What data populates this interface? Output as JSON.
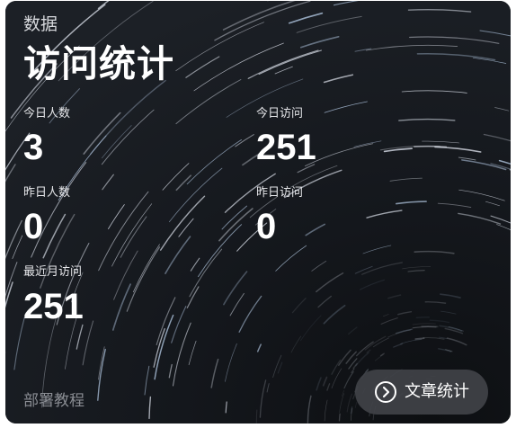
{
  "card": {
    "category": "数据",
    "title": "访问统计",
    "stats": [
      {
        "label": "今日人数",
        "value": "3"
      },
      {
        "label": "今日访问",
        "value": "251"
      },
      {
        "label": "昨日人数",
        "value": "0"
      },
      {
        "label": "昨日访问",
        "value": "0"
      },
      {
        "label": "最近月访问",
        "value": "251"
      }
    ],
    "footer_link": "部署教程",
    "action_button": {
      "label": "文章统计",
      "icon": "chevron-right-circle-icon"
    }
  },
  "colors": {
    "card_background": "#101216",
    "button_background": "#404248",
    "muted_text": "#8a8d93"
  }
}
